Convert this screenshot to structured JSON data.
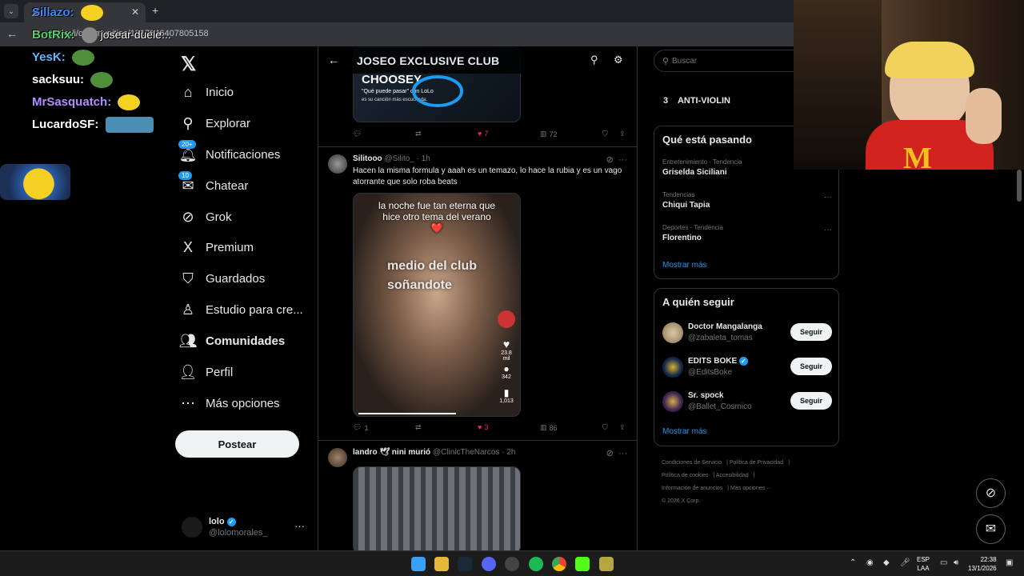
{
  "browser": {
    "tab_title": "X",
    "url": "x.com/i/communities/1817646407805158"
  },
  "overlay": {
    "chat": [
      {
        "user": "Sillazo:",
        "color": "#3b8cff",
        "message": ""
      },
      {
        "user": "BotRix:",
        "color": "#52d36b",
        "message": "josear duele..."
      },
      {
        "user": "YesK:",
        "color": "#5fb8ff",
        "message": ""
      },
      {
        "user": "sacksuu:",
        "color": "#ffffff",
        "message": ""
      },
      {
        "user": "MrSasquatch:",
        "color": "#b48cff",
        "message": ""
      },
      {
        "user": "LucardoSF:",
        "color": "#ffffff",
        "message": ""
      }
    ]
  },
  "sidebar": {
    "items": [
      {
        "label": "Inicio",
        "icon": "home-icon",
        "glyph": "⌂"
      },
      {
        "label": "Explorar",
        "icon": "search-icon",
        "glyph": "⚲"
      },
      {
        "label": "Notificaciones",
        "icon": "bell-icon",
        "glyph": "🔔︎",
        "badge": "20+"
      },
      {
        "label": "Chatear",
        "icon": "mail-icon",
        "glyph": "✉",
        "badge": "10"
      },
      {
        "label": "Grok",
        "icon": "grok-icon",
        "glyph": "⊘"
      },
      {
        "label": "Premium",
        "icon": "x-icon",
        "glyph": "X"
      },
      {
        "label": "Guardados",
        "icon": "bookmark-icon",
        "glyph": "⛉"
      },
      {
        "label": "Estudio para cre...",
        "icon": "studio-icon",
        "glyph": "♙"
      },
      {
        "label": "Comunidades",
        "icon": "communities-icon",
        "glyph": "👥︎"
      },
      {
        "label": "Perfil",
        "icon": "profile-icon",
        "glyph": "👤︎"
      },
      {
        "label": "Más opciones",
        "icon": "more-icon",
        "glyph": "⋯"
      }
    ],
    "post_button": "Postear",
    "profile": {
      "name": "lolo",
      "handle": "@lolomorales_"
    }
  },
  "main": {
    "title": "JOSEO EXCLUSIVE CLUB",
    "post_top": {
      "media_text": "CHOOSEY",
      "media_sub1": "\"Qué puede pasar\" con LoLo",
      "media_sub2": "es su canción más escuchada.",
      "replies": "",
      "reposts": "",
      "likes": "7",
      "views": "72"
    },
    "post_1": {
      "name": "Silitooo",
      "handle": "@Silito_",
      "time": "· 1h",
      "text": "Hacen la misma formula y aaah es un temazo, lo hace la rubia y es un vago atorrante que solo roba beats",
      "video_caption": "la noche fue tan eterna que hice otro tema del verano ❤️",
      "video_big_1": "medio del club",
      "video_big_2": "soñandote",
      "video_likes": "23.8 mil",
      "video_comments": "342",
      "video_saves": "1,013",
      "replies": "1",
      "reposts": "",
      "likes": "3",
      "views": "86"
    },
    "post_2": {
      "name": "landro 🕊 nini murió",
      "handle": "@ClinicTheNarcos",
      "time": "· 2h"
    }
  },
  "right": {
    "search_placeholder": "Buscar",
    "top_trend": {
      "rank": "3",
      "name": "ANTI-VIOLIN"
    },
    "happening": {
      "title": "Qué está pasando",
      "trends": [
        {
          "category": "Entretenimiento · Tendencia",
          "name": "Griselda Siciliani"
        },
        {
          "category": "Tendencias",
          "name": "Chiqui Tapia"
        },
        {
          "category": "Deportes · Tendencia",
          "name": "Florentino"
        }
      ],
      "show_more": "Mostrar más"
    },
    "who_to_follow": {
      "title": "A quién seguir",
      "accounts": [
        {
          "name": "Doctor Mangalanga",
          "handle": "@zabaleta_tomas",
          "verified": false
        },
        {
          "name": "EDITS BOKE",
          "handle": "@EditsBoke",
          "verified": true
        },
        {
          "name": "Sr. spock",
          "handle": "@Ballet_Cosmico",
          "verified": false
        }
      ],
      "follow_label": "Seguir",
      "show_more": "Mostrar más"
    },
    "footer": {
      "links": [
        "Condiciones de Servicio",
        "Política de Privacidad",
        "Política de cookies",
        "Accesibilidad",
        "Información de anuncios",
        "Más opciones ···"
      ],
      "copyright": "© 2026 X Corp."
    }
  },
  "taskbar": {
    "lang_1": "ESP",
    "lang_2": "LAA",
    "time": "22:38",
    "date": "13/1/2026"
  },
  "colors": {
    "accent": "#1d9bf0",
    "like": "#f91880",
    "background": "#000000",
    "border": "#2f3336"
  }
}
